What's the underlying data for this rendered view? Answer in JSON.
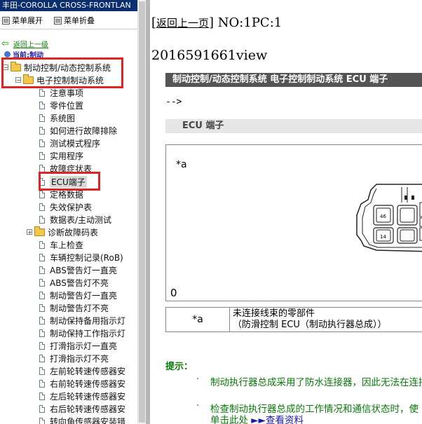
{
  "left_pane": {
    "title": "丰田-COROLLA CROSS-FRONTLAN",
    "toolbar": {
      "expand": "菜单展开",
      "collapse": "菜单折叠"
    },
    "back_link": "返回上一级",
    "current_position": "当前:制动",
    "tree": [
      {
        "label": "制动控制/动态控制系统",
        "type": "folder",
        "expanded": true
      },
      {
        "label": "电子控制制动系统",
        "type": "folder",
        "expanded": true
      },
      {
        "label": "注意事项",
        "type": "doc"
      },
      {
        "label": "零件位置",
        "type": "doc"
      },
      {
        "label": "系统图",
        "type": "doc"
      },
      {
        "label": "如何进行故障排除",
        "type": "doc"
      },
      {
        "label": "测试模式程序",
        "type": "doc"
      },
      {
        "label": "实用程序",
        "type": "doc"
      },
      {
        "label": "故障症状表",
        "type": "doc"
      },
      {
        "label": "ECU端子",
        "type": "doc",
        "selected": true
      },
      {
        "label": "定格数据",
        "type": "doc"
      },
      {
        "label": "失效保护表",
        "type": "doc"
      },
      {
        "label": "数据表/主动测试",
        "type": "doc"
      },
      {
        "label": "诊断故障码表",
        "type": "folder",
        "expanded": false
      },
      {
        "label": "车上检查",
        "type": "doc"
      },
      {
        "label": "车辆控制记录(RoB)",
        "type": "doc"
      },
      {
        "label": "ABS警告灯一直亮",
        "type": "doc"
      },
      {
        "label": "ABS警告灯不亮",
        "type": "doc"
      },
      {
        "label": "制动警告灯一直亮",
        "type": "doc"
      },
      {
        "label": "制动警告灯不亮",
        "type": "doc"
      },
      {
        "label": "制动保持备用指示灯",
        "type": "doc"
      },
      {
        "label": "制动保持工作指示灯",
        "type": "doc"
      },
      {
        "label": "打滑指示灯一直亮",
        "type": "doc"
      },
      {
        "label": "打滑指示灯不亮",
        "type": "doc"
      },
      {
        "label": "左前轮转速传感器安",
        "type": "doc"
      },
      {
        "label": "右前轮转速传感器安",
        "type": "doc"
      },
      {
        "label": "左后轮转速传感器安",
        "type": "doc"
      },
      {
        "label": "右后轮转速传感器安",
        "type": "doc"
      },
      {
        "label": "转向角传感器安装错",
        "type": "doc"
      }
    ]
  },
  "right_pane": {
    "back_link": "返回上一页",
    "nav_no": "NO:1PC:1",
    "view_line": "2016591661view",
    "section_title": "制动控制/动态控制系统  电子控制制动系统  ECU 端子",
    "arrow_text": "-->",
    "sub_title": "ECU 端子",
    "figure": {
      "label_a": "*a",
      "label_o": "0",
      "pin_labels": [
        "46",
        "45",
        "14",
        "13"
      ]
    },
    "legend": {
      "key": "*a",
      "line1": "未连接线束的零部件",
      "line2": "（防滑控制 ECU（制动执行器总成））"
    },
    "hint_title": "提示：",
    "hints": [
      "制动执行器总成采用了防水连接器，因此无法在连接",
      "检查制动执行器总成的工作情况和通信状态时，使"
    ],
    "hint_tail": "单击此处",
    "lookup_link": "►►查看资料"
  },
  "colors": {
    "title_bg": "#0a2e6e",
    "highlight": "#e02424",
    "hint_green": "#0a7a0a",
    "section_bg": "#555555"
  }
}
